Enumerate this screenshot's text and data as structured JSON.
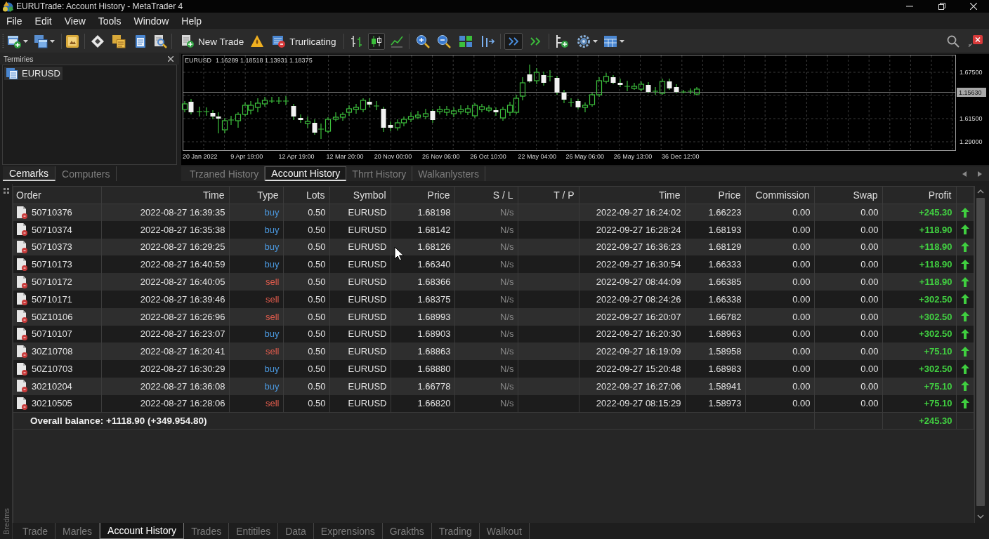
{
  "window": {
    "title": "EURUTrade: Account History - MetaTrader 4"
  },
  "menu": [
    "File",
    "Edit",
    "View",
    "Tools",
    "Window",
    "Help"
  ],
  "toolbar": {
    "new_trade_label": "New Trade",
    "trading_label": "Trurlicating",
    "chart_type_buttons": [
      {
        "pressed": false
      },
      {
        "pressed": true
      },
      {
        "pressed": false
      }
    ],
    "scroll_buttons": [
      {
        "pressed": true
      },
      {
        "pressed": false
      }
    ]
  },
  "navigator": {
    "title": "Termiries",
    "items": [
      {
        "label": "EURUSD",
        "selected": true
      }
    ],
    "tabs": [
      {
        "label": "Cemarks",
        "selected": true
      },
      {
        "label": "Computers",
        "selected": false
      }
    ]
  },
  "chart": {
    "symbol": "EURUSD",
    "ohlc": "1.16289 1.18518 1.13931 1.18375",
    "price_labels": [
      "1.67500",
      "1.61500",
      "1.29000"
    ],
    "current_price": "1.15630",
    "time_labels": [
      "20 Jan 2022",
      "9 Apr 19:00",
      "12 Apr 19:00",
      "12 Mar 20:00",
      "20 Nov 00:00",
      "26 Nov 06:00",
      "26 Oct 10:00",
      "22 May 04:00",
      "26 May 06:00",
      "26 May 13:00",
      "36 Dec 12:00"
    ]
  },
  "chart_tabs": [
    {
      "label": "Trzaned History",
      "selected": false
    },
    {
      "label": "Account History",
      "selected": true
    },
    {
      "label": "Thrrt History",
      "selected": false
    },
    {
      "label": "Walkanlysters",
      "selected": false
    }
  ],
  "terminal": {
    "side_label": "Bredms",
    "columns": [
      "Order",
      "Time",
      "Type",
      "Lots",
      "Symbol",
      "Price",
      "S / L",
      "T / P",
      "Time",
      "Price",
      "Commission",
      "Swap",
      "Profit"
    ],
    "rows": [
      {
        "order": "50710376",
        "open_time": "2022-08-27 16:39:35",
        "type": "buy",
        "color": "#4a96db",
        "lots": "0.50",
        "symbol": "EURUSD",
        "open_price": "1.68198",
        "sl": "N/s",
        "close_time": "2022-09-27 16:24:02",
        "close_price": "1.66223",
        "commission": "0.00",
        "swap": "0.00",
        "profit": "+245.30"
      },
      {
        "order": "50710374",
        "open_time": "2022-08-27 16:35:38",
        "type": "buy",
        "color": "#4a96db",
        "lots": "0.50",
        "symbol": "EURUSD",
        "open_price": "1.68142",
        "sl": "N/s",
        "close_time": "2022-09-27 16:28:24",
        "close_price": "1.68193",
        "commission": "0.00",
        "swap": "0.00",
        "profit": "+118.90"
      },
      {
        "order": "50710373",
        "open_time": "2022-08-27 16:29:25",
        "type": "buy",
        "color": "#4a96db",
        "lots": "0.50",
        "symbol": "EURUSD",
        "open_price": "1.68126",
        "sl": "N/s",
        "close_time": "2022-09-27 16:36:23",
        "close_price": "1.68129",
        "commission": "0.00",
        "swap": "0.00",
        "profit": "+118.90"
      },
      {
        "order": "50710173",
        "open_time": "2022-08-27 16:40:59",
        "type": "buy",
        "color": "#4a96db",
        "lots": "0.50",
        "symbol": "EURUSD",
        "open_price": "1.66340",
        "sl": "N/s",
        "close_time": "2022-09-27 16:30:54",
        "close_price": "1.66333",
        "commission": "0.00",
        "swap": "0.00",
        "profit": "+118.90"
      },
      {
        "order": "50710172",
        "open_time": "2022-08-27 16:40:05",
        "type": "sell",
        "color": "#e05b4c",
        "lots": "0.50",
        "symbol": "EURUSD",
        "open_price": "1.68366",
        "sl": "N/s",
        "close_time": "2022-09-27 08:44:09",
        "close_price": "1.66385",
        "commission": "0.00",
        "swap": "0.00",
        "profit": "+118.90"
      },
      {
        "order": "50710171",
        "open_time": "2022-08-27 16:39:46",
        "type": "sell",
        "color": "#e05b4c",
        "lots": "0.50",
        "symbol": "EURUSD",
        "open_price": "1.68375",
        "sl": "N/s",
        "close_time": "2022-09-27 08:24:26",
        "close_price": "1.66338",
        "commission": "0.00",
        "swap": "0.00",
        "profit": "+302.50"
      },
      {
        "order": "50Z10106",
        "open_time": "2022-08-27 16:26:96",
        "type": "sell",
        "color": "#e05b4c",
        "lots": "0.50",
        "symbol": "EURUSD",
        "open_price": "1.68993",
        "sl": "N/s",
        "close_time": "2022-09-27 16:20:07",
        "close_price": "1.66782",
        "commission": "0.00",
        "swap": "0.00",
        "profit": "+302.50"
      },
      {
        "order": "50710107",
        "open_time": "2022-08-27 16:23:07",
        "type": "buy",
        "color": "#4a96db",
        "lots": "0.50",
        "symbol": "EURUSD",
        "open_price": "1.68903",
        "sl": "N/s",
        "close_time": "2022-09-27 16:20:30",
        "close_price": "1.68963",
        "commission": "0.00",
        "swap": "0.00",
        "profit": "+302.50"
      },
      {
        "order": "30Z10708",
        "open_time": "2022-08-27 16:20:41",
        "type": "sell",
        "color": "#e05b4c",
        "lots": "0.50",
        "symbol": "EURUSD",
        "open_price": "1.68863",
        "sl": "N/s",
        "close_time": "2022-09-27 16:19:09",
        "close_price": "1.58958",
        "commission": "0.00",
        "swap": "0.00",
        "profit": "+75.10"
      },
      {
        "order": "50Z10703",
        "open_time": "2022-08-27 16:30:29",
        "type": "buy",
        "color": "#4a96db",
        "lots": "0.50",
        "symbol": "EURUSD",
        "open_price": "1.68880",
        "sl": "N/s",
        "close_time": "2022-09-27 15:20:48",
        "close_price": "1.68983",
        "commission": "0.00",
        "swap": "0.00",
        "profit": "+302.50"
      },
      {
        "order": "30210204",
        "open_time": "2022-08-27 16:36:08",
        "type": "buy",
        "color": "#4a96db",
        "lots": "0.50",
        "symbol": "EURUSD",
        "open_price": "1.66778",
        "sl": "N/s",
        "close_time": "2022-09-27 16:27:06",
        "close_price": "1.58941",
        "commission": "0.00",
        "swap": "0.00",
        "profit": "+75.10"
      },
      {
        "order": "30210505",
        "open_time": "2022-08-27 16:28:06",
        "type": "sell",
        "color": "#e05b4c",
        "lots": "0.50",
        "symbol": "EURUSD",
        "open_price": "1.66820",
        "sl": "N/s",
        "close_time": "2022-09-27 08:15:29",
        "close_price": "1.58973",
        "commission": "0.00",
        "swap": "0.00",
        "profit": "+75.10"
      }
    ],
    "summary": {
      "label": "Overall balance: +1118.90 (+349.954.80)",
      "profit": "+245.30"
    },
    "tabs": [
      {
        "label": "Trade",
        "selected": false
      },
      {
        "label": "Marles",
        "selected": false
      },
      {
        "label": "Account History",
        "selected": true
      },
      {
        "label": "Trades",
        "selected": false
      },
      {
        "label": "Entitiles",
        "selected": false
      },
      {
        "label": "Data",
        "selected": false
      },
      {
        "label": "Exprensions",
        "selected": false
      },
      {
        "label": "Grakths",
        "selected": false
      },
      {
        "label": "Trading",
        "selected": false
      },
      {
        "label": "Walkout",
        "selected": false
      }
    ]
  }
}
